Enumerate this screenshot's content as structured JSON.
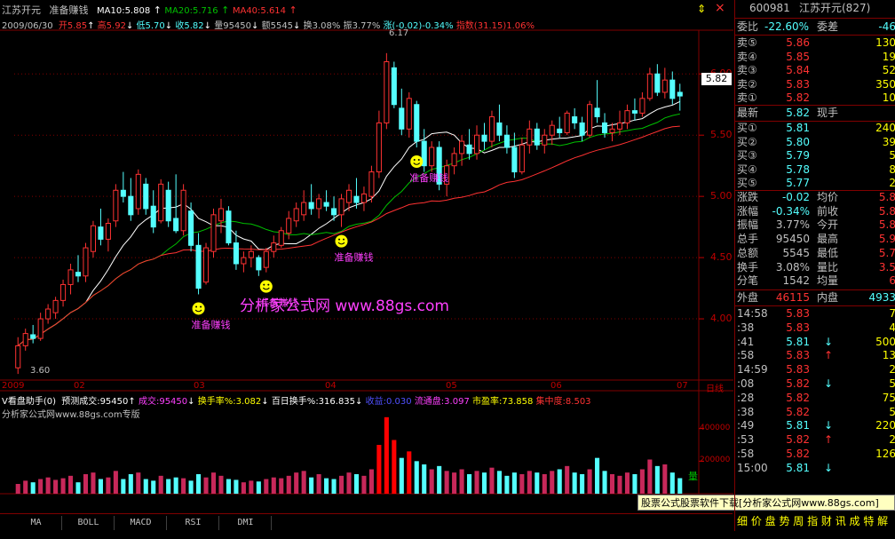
{
  "colors": {
    "up": "#ff3232",
    "down": "#54ffff",
    "ma10": "#ffffff",
    "ma20": "#00c000",
    "ma40": "#ff3232",
    "magenta": "#ff40ff",
    "yellow": "#ffff00",
    "grid": "#800000",
    "axis": "#c00000"
  },
  "header": {
    "stock_name": "江苏开元",
    "indicator_name": "准备赚钱",
    "ma10_label": "MA10:5.808",
    "ma20_label": "MA20:5.716",
    "ma40_label": "MA40:5.614",
    "date": "2009/06/30",
    "open": "开5.85",
    "high": "高5.92",
    "low": "低5.70",
    "close": "收5.82",
    "volume": "量95450",
    "amount": "额5545",
    "turnover": "换3.08%",
    "amplitude": "振3.77%",
    "change": "涨(-0.02)-0.34%",
    "index_label": "指数(31.15)1.06%"
  },
  "sub_header": {
    "title": "V看盘助手(0)",
    "forecast": "预测成交:95450",
    "deal": "成交:95450",
    "turnover_rate": "换手率%:3.082",
    "hundred_day": "百日换手%:316.835",
    "return": "收益:0.030",
    "float": "流通盘:3.097",
    "pe": "市盈率:73.858",
    "concentration": "集中度:8.503",
    "watermark2": "分析家公式网www.88gs.com专版"
  },
  "watermark": "分析家公式网 www.88gs.com",
  "marker_text": "准备赚钱",
  "high_annotation": "6.17",
  "low_annotation": "3.60",
  "last_price_tag": "5.82",
  "tabs": [
    "MA",
    "BOLL",
    "MACD",
    "RSI",
    "DMI"
  ],
  "price_ticks": [
    "6.00",
    "5.50",
    "5.00",
    "4.50",
    "4.00"
  ],
  "volume_ticks": [
    "400000",
    "200000"
  ],
  "volume_label": "量",
  "date_labels": [
    "2009",
    "02",
    "03",
    "04",
    "05",
    "06",
    "07",
    "日线"
  ],
  "footer_banner": "股票公式股票软件下载[分析家公式网www.88gs.com]",
  "bottom_tabs": "细 价 盘 势 周 指 财 讯 成 特 解",
  "chart_data": {
    "type": "candlestick",
    "ylim": [
      3.5,
      6.35
    ],
    "candles": [
      [
        3.6,
        3.85,
        3.55,
        3.78
      ],
      [
        3.78,
        3.92,
        3.74,
        3.88
      ],
      [
        3.87,
        3.95,
        3.8,
        3.84
      ],
      [
        3.84,
        4.05,
        3.82,
        4.0
      ],
      [
        4.0,
        4.12,
        3.96,
        4.08
      ],
      [
        4.05,
        4.18,
        4.0,
        4.15
      ],
      [
        4.15,
        4.32,
        4.1,
        4.28
      ],
      [
        4.28,
        4.45,
        4.2,
        4.4
      ],
      [
        4.38,
        4.52,
        4.3,
        4.35
      ],
      [
        4.35,
        4.62,
        4.3,
        4.58
      ],
      [
        4.55,
        4.8,
        4.5,
        4.76
      ],
      [
        4.75,
        4.9,
        4.6,
        4.65
      ],
      [
        4.65,
        4.82,
        4.55,
        4.78
      ],
      [
        4.8,
        5.1,
        4.75,
        5.05
      ],
      [
        5.05,
        5.2,
        4.95,
        5.0
      ],
      [
        5.0,
        5.15,
        4.8,
        4.85
      ],
      [
        4.9,
        5.22,
        4.85,
        5.18
      ],
      [
        5.1,
        5.15,
        4.85,
        4.9
      ],
      [
        4.92,
        5.05,
        4.7,
        4.75
      ],
      [
        4.8,
        5.14,
        4.78,
        5.1
      ],
      [
        5.05,
        5.12,
        4.75,
        4.8
      ],
      [
        4.82,
        5.18,
        4.7,
        4.72
      ],
      [
        4.72,
        5.1,
        4.68,
        5.05
      ],
      [
        4.88,
        4.95,
        4.55,
        4.6
      ],
      [
        4.6,
        4.7,
        4.2,
        4.25
      ],
      [
        4.3,
        4.62,
        4.28,
        4.58
      ],
      [
        4.55,
        4.9,
        4.5,
        4.85
      ],
      [
        4.8,
        4.98,
        4.7,
        4.9
      ],
      [
        4.88,
        4.92,
        4.6,
        4.62
      ],
      [
        4.62,
        4.72,
        4.4,
        4.45
      ],
      [
        4.45,
        4.55,
        4.38,
        4.5
      ],
      [
        4.5,
        4.6,
        4.42,
        4.55
      ],
      [
        4.5,
        4.52,
        4.35,
        4.4
      ],
      [
        4.42,
        4.58,
        4.38,
        4.55
      ],
      [
        4.55,
        4.68,
        4.5,
        4.62
      ],
      [
        4.6,
        4.75,
        4.58,
        4.72
      ],
      [
        4.7,
        4.88,
        4.65,
        4.82
      ],
      [
        4.8,
        4.95,
        4.75,
        4.9
      ],
      [
        4.85,
        5.05,
        4.8,
        4.95
      ],
      [
        4.95,
        5.1,
        4.85,
        4.9
      ],
      [
        4.9,
        5.02,
        4.82,
        4.98
      ],
      [
        4.95,
        5.05,
        4.88,
        4.92
      ],
      [
        4.9,
        5.0,
        4.8,
        4.85
      ],
      [
        4.85,
        5.02,
        4.75,
        4.98
      ],
      [
        4.95,
        5.1,
        4.88,
        5.05
      ],
      [
        5.0,
        5.15,
        4.9,
        4.95
      ],
      [
        4.95,
        5.08,
        4.88,
        5.02
      ],
      [
        5.0,
        5.25,
        4.95,
        5.2
      ],
      [
        5.2,
        5.7,
        5.15,
        5.6
      ],
      [
        5.6,
        6.17,
        5.55,
        6.1
      ],
      [
        6.05,
        6.1,
        5.72,
        5.75
      ],
      [
        5.72,
        5.88,
        5.5,
        5.55
      ],
      [
        5.55,
        5.85,
        5.48,
        5.8
      ],
      [
        5.75,
        5.78,
        5.4,
        5.45
      ],
      [
        5.45,
        5.55,
        5.2,
        5.25
      ],
      [
        5.25,
        5.45,
        5.2,
        5.4
      ],
      [
        5.4,
        5.45,
        5.05,
        5.1
      ],
      [
        5.1,
        5.3,
        5.0,
        5.25
      ],
      [
        5.25,
        5.4,
        5.18,
        5.35
      ],
      [
        5.35,
        5.5,
        5.25,
        5.45
      ],
      [
        5.42,
        5.55,
        5.3,
        5.35
      ],
      [
        5.35,
        5.58,
        5.3,
        5.5
      ],
      [
        5.5,
        5.6,
        5.38,
        5.45
      ],
      [
        5.45,
        5.7,
        5.4,
        5.65
      ],
      [
        5.6,
        5.75,
        5.45,
        5.5
      ],
      [
        5.5,
        5.58,
        5.35,
        5.4
      ],
      [
        5.4,
        5.52,
        5.15,
        5.2
      ],
      [
        5.2,
        5.48,
        5.18,
        5.42
      ],
      [
        5.42,
        5.62,
        5.35,
        5.55
      ],
      [
        5.55,
        5.6,
        5.38,
        5.42
      ],
      [
        5.42,
        5.55,
        5.35,
        5.5
      ],
      [
        5.5,
        5.62,
        5.42,
        5.58
      ],
      [
        5.55,
        5.65,
        5.48,
        5.52
      ],
      [
        5.52,
        5.7,
        5.5,
        5.68
      ],
      [
        5.65,
        5.72,
        5.55,
        5.6
      ],
      [
        5.6,
        5.65,
        5.45,
        5.5
      ],
      [
        5.5,
        5.78,
        5.48,
        5.75
      ],
      [
        5.72,
        5.95,
        5.6,
        5.65
      ],
      [
        5.6,
        5.68,
        5.48,
        5.52
      ],
      [
        5.52,
        5.6,
        5.45,
        5.55
      ],
      [
        5.55,
        5.7,
        5.5,
        5.6
      ],
      [
        5.6,
        5.75,
        5.55,
        5.7
      ],
      [
        5.7,
        5.8,
        5.62,
        5.68
      ],
      [
        5.68,
        5.85,
        5.65,
        5.8
      ],
      [
        5.8,
        6.05,
        5.78,
        6.0
      ],
      [
        6.0,
        6.08,
        5.82,
        5.85
      ],
      [
        5.85,
        6.05,
        5.8,
        5.95
      ],
      [
        5.95,
        6.02,
        5.75,
        5.8
      ],
      [
        5.85,
        5.92,
        5.7,
        5.82
      ]
    ],
    "volumes": [
      60000,
      80000,
      70000,
      90000,
      100000,
      85000,
      95000,
      110000,
      70000,
      120000,
      130000,
      90000,
      100000,
      140000,
      90000,
      120000,
      130000,
      90000,
      80000,
      110000,
      90000,
      100000,
      95000,
      80000,
      120000,
      100000,
      130000,
      110000,
      90000,
      85000,
      70000,
      80000,
      75000,
      90000,
      100000,
      95000,
      110000,
      130000,
      140000,
      100000,
      120000,
      95000,
      90000,
      110000,
      130000,
      120000,
      110000,
      150000,
      300000,
      470000,
      330000,
      220000,
      260000,
      200000,
      180000,
      150000,
      170000,
      140000,
      130000,
      150000,
      120000,
      140000,
      130000,
      160000,
      140000,
      110000,
      130000,
      120000,
      140000,
      130000,
      120000,
      140000,
      150000,
      170000,
      130000,
      120000,
      150000,
      220000,
      140000,
      120000,
      110000,
      130000,
      120000,
      150000,
      210000,
      170000,
      180000,
      130000,
      95450
    ],
    "markers": [
      24,
      33,
      43,
      53
    ]
  },
  "quote": {
    "code": "600981",
    "name": "江苏开元(827)",
    "weibi_label": "委比",
    "weibi": "-22.60%",
    "weicha_label": "委差",
    "weicha": "-46",
    "sells": [
      {
        "l": "卖⑤",
        "p": "5.86",
        "v": "130"
      },
      {
        "l": "卖④",
        "p": "5.85",
        "v": "19"
      },
      {
        "l": "卖③",
        "p": "5.84",
        "v": "52"
      },
      {
        "l": "卖②",
        "p": "5.83",
        "v": "350"
      },
      {
        "l": "卖①",
        "p": "5.82",
        "v": "10"
      }
    ],
    "last_label": "最新",
    "last": "5.82",
    "now_hand_label": "现手",
    "buys": [
      {
        "l": "买①",
        "p": "5.81",
        "v": "240"
      },
      {
        "l": "买②",
        "p": "5.80",
        "v": "39"
      },
      {
        "l": "买③",
        "p": "5.79",
        "v": "5"
      },
      {
        "l": "买④",
        "p": "5.78",
        "v": "8"
      },
      {
        "l": "买⑤",
        "p": "5.77",
        "v": "2"
      }
    ],
    "stats": [
      {
        "a": "涨跌",
        "b": "-0.02",
        "c": "均价",
        "d": "5.8"
      },
      {
        "a": "涨幅",
        "b": "-0.34%",
        "c": "前收",
        "d": "5.8"
      },
      {
        "a": "振幅",
        "b": "3.77%",
        "c": "今开",
        "d": "5.8"
      },
      {
        "a": "总手",
        "b": "95450",
        "c": "最高",
        "d": "5.9"
      },
      {
        "a": "总额",
        "b": "5545",
        "c": "最低",
        "d": "5.7"
      },
      {
        "a": "换手",
        "b": "3.08%",
        "c": "量比",
        "d": "3.5"
      },
      {
        "a": "分笔",
        "b": "1542",
        "c": "均量",
        "d": "6"
      }
    ],
    "outer_label": "外盘",
    "outer": "46115",
    "inner_label": "内盘",
    "inner": "4933",
    "ticks": [
      {
        "t": "14:58",
        "p": "5.83",
        "v": "7",
        "d": ""
      },
      {
        "t": ":38",
        "p": "5.83",
        "v": "4",
        "d": ""
      },
      {
        "t": ":41",
        "p": "5.81",
        "v": "500",
        "d": "↓"
      },
      {
        "t": ":58",
        "p": "5.83",
        "v": "13",
        "d": "↑"
      },
      {
        "t": "14:59",
        "p": "5.83",
        "v": "2",
        "d": ""
      },
      {
        "t": ":08",
        "p": "5.82",
        "v": "5",
        "d": "↓"
      },
      {
        "t": ":28",
        "p": "5.82",
        "v": "75",
        "d": ""
      },
      {
        "t": ":38",
        "p": "5.82",
        "v": "5",
        "d": ""
      },
      {
        "t": ":49",
        "p": "5.81",
        "v": "220",
        "d": "↓"
      },
      {
        "t": ":53",
        "p": "5.82",
        "v": "2",
        "d": "↑"
      },
      {
        "t": ":58",
        "p": "5.82",
        "v": "126",
        "d": ""
      },
      {
        "t": "15:00",
        "p": "5.81",
        "v": "",
        "d": "↓"
      }
    ]
  }
}
